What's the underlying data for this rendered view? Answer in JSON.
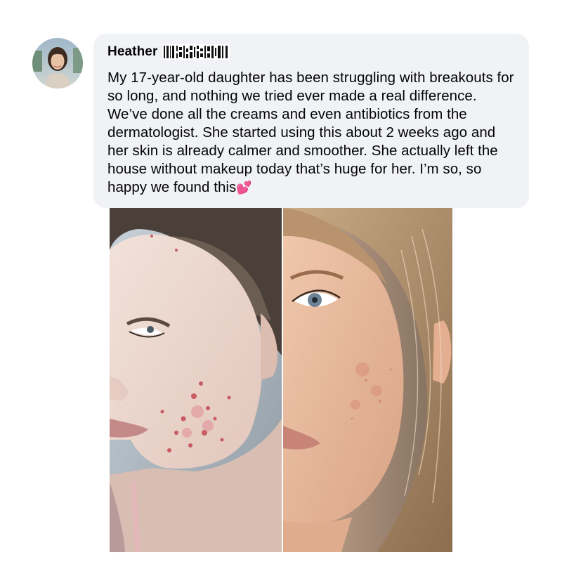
{
  "comment": {
    "author_name": "Heather",
    "author_suffix_redacted": true,
    "text": "My 17-year-old daughter has been struggling with breakouts for so long, and nothing we tried ever made a real difference. We’ve done all the creams and even antibiotics from the dermatologist. She started using this about 2 weeks ago and her skin is already calmer and smoother. She actually left the house without makeup today that’s huge for her. I’m so, so happy we found this",
    "emoji": "💕",
    "emoji_icon": "two-hearts-icon"
  },
  "attachment": {
    "type": "before-after-photo",
    "panels": [
      "before",
      "after"
    ]
  },
  "colors": {
    "bubble_background": "#f0f2f5",
    "text": "#050505",
    "emoji": "#e8255a"
  }
}
